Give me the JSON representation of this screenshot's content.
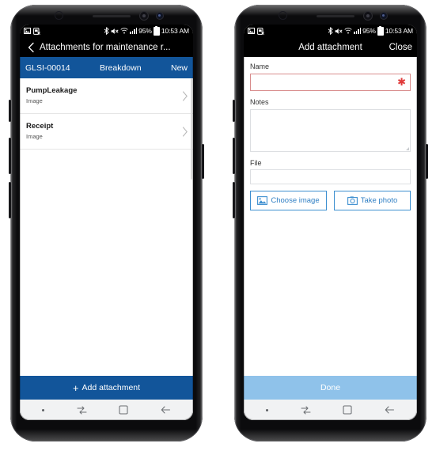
{
  "colors": {
    "accent_blue": "#12559a",
    "accent_blue_disabled": "#8fc2ea",
    "link_blue": "#2f7fc4",
    "required_red": "#e03b3b",
    "required_border": "#d98d8d",
    "statusbar_bg": "#000000",
    "navbar_bg": "#f1f2f3",
    "phone_body": "#0b0b0d"
  },
  "status_bar": {
    "battery_percent": "95%",
    "time": "10:53 AM",
    "icons": [
      "image-icon",
      "no-sim-icon",
      "bluetooth-icon",
      "mute-icon",
      "wifi-icon",
      "signal-bars-icon",
      "battery-icon"
    ]
  },
  "left_phone": {
    "title_bar": {
      "back_icon": "chevron-left-icon",
      "title": "Attachments for maintenance r..."
    },
    "record_header": {
      "id": "GLSI-00014",
      "type": "Breakdown",
      "status": "New"
    },
    "attachments": [
      {
        "name": "PumpLeakage",
        "type": "Image",
        "chevron": "chevron-right-icon"
      },
      {
        "name": "Receipt",
        "type": "Image",
        "chevron": "chevron-right-icon"
      }
    ],
    "action_button": {
      "icon": "plus-icon",
      "label": "Add attachment"
    }
  },
  "right_phone": {
    "title_bar": {
      "title": "Add attachment",
      "close_label": "Close"
    },
    "form": {
      "name": {
        "label": "Name",
        "value": "",
        "placeholder": "",
        "required_marker": "✱"
      },
      "notes": {
        "label": "Notes",
        "value": "",
        "placeholder": ""
      },
      "file": {
        "label": "File",
        "value": "",
        "placeholder": ""
      },
      "buttons": [
        {
          "label": "Choose image",
          "icon": "image-picture-icon"
        },
        {
          "label": "Take photo",
          "icon": "camera-icon"
        }
      ]
    },
    "action_button": {
      "label": "Done",
      "enabled": false
    }
  },
  "nav_bar": {
    "items": [
      {
        "name": "dot-indicator",
        "icon": "dot-icon"
      },
      {
        "name": "recents",
        "icon": "recents-icon"
      },
      {
        "name": "home",
        "icon": "home-square-icon"
      },
      {
        "name": "back",
        "icon": "arrow-left-icon"
      }
    ]
  }
}
